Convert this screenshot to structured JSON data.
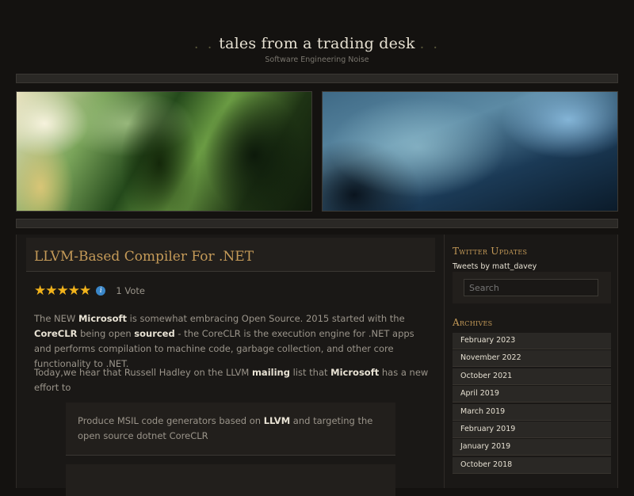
{
  "site": {
    "title": "tales from a trading desk",
    "dots_left": ". .",
    "dots_right": ". .",
    "tagline": "Software Engineering Noise"
  },
  "post": {
    "title": "LLVM-Based Compiler For .NET",
    "rating": {
      "stars": 5,
      "max_stars": 5,
      "vote_text": "1 Vote",
      "stars_glyph": "★★★★★"
    },
    "p1": {
      "t1": "The NEW ",
      "b1": "Microsoft",
      "t2": " is somewhat embracing Open Source.  2015 started with the ",
      "b2": "CoreCLR",
      "t3": " being open ",
      "b3": "sourced",
      "t4": " - the CoreCLR is the execution engine for .NET apps and performs compilation to machine code, garbage collection, and other core functionality to .NET."
    },
    "p2": {
      "t1": "Today,we hear that Russell Hadley on the LLVM ",
      "b1": "mailing",
      "t2": " list that ",
      "b2": "Microsoft",
      "t3": " has a new effort to"
    },
    "quote": {
      "t1": "Produce MSIL code generators based on ",
      "b1": "LLVM",
      "t2": " and targeting the open source dotnet CoreCLR"
    }
  },
  "sidebar": {
    "twitter_title": "Twitter Updates",
    "tweets_by": "Tweets by matt_davey",
    "search_placeholder": "Search",
    "archives_title": "Archives",
    "archives": [
      "February 2023",
      "November 2022",
      "October 2021",
      "April 2019",
      "March 2019",
      "February 2019",
      "January 2019",
      "October 2018"
    ]
  },
  "colors": {
    "background": "#141210",
    "accent_gold": "#c49a58",
    "star": "#f2b31b",
    "info_blue": "#3a86c8"
  },
  "icons": [
    "star-icon",
    "info-icon"
  ]
}
